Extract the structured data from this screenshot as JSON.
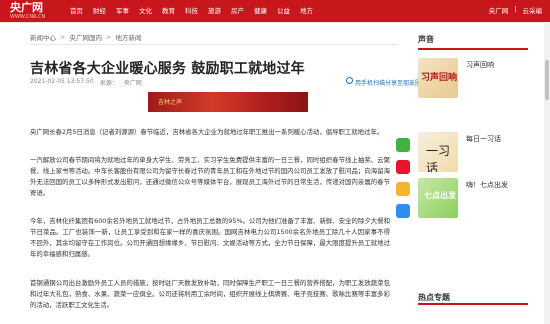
{
  "header": {
    "logo": "央广网",
    "logo_sub": "WWW.CNR.CN",
    "nav": [
      "首页",
      "财经",
      "军事",
      "文化",
      "教育",
      "科技",
      "旅游",
      "房产",
      "健康",
      "公益",
      "地方"
    ],
    "right": [
      "央广网",
      "|",
      "云采编"
    ]
  },
  "breadcrumb": [
    "新闻中心",
    ">",
    "央广网国内",
    ">",
    "地方新闻"
  ],
  "article": {
    "title": "吉林省各大企业暖心服务 鼓励职工就地过年",
    "time": "2021-02-05 13:57:50",
    "source_label": "来源：",
    "source": "央广网",
    "share_text": "用手机扫描分享至朋友圈",
    "photo_caption": "吉林之声",
    "paragraphs": [
      "央广网长春2月5日消息（记者刘源源）春节临近，吉林省各大企业为就地过年职工推出一系列暖心活动，倡导职工就地过年。",
      "一汽解放公司春节期间将为就地过年的单身大学生、劳务工、实习学生免费提供丰富的一日三餐，同时组织春节线上抽奖、云聚餐、线上家书等活动。中车长客股份有限公司为留守长春过节的青年员工和在外地过节的国内公司员工发放了慰问品；向海留海外无法回国的员工以多种形式发出慰问，还通过微信公众号等媒体平台，展现员工海外过节的日常生活，传递对国内亲属的春节寄语。",
      "今年，吉林化纤集团有600余名外地员工就地过节，占外地员工总数的95%。公司为他们准备了丰富、新鲜、安全的除夕大餐和节日菜品。工厂也装饰一新，让员工享受到和在家一样的喜庆氛围。国网吉林电力公司1500余名外地员工除几十人因家事不得不回外，其余均留守在工作岗位。公司开通回想缘缘乡、节日慰问、文娱活动等方式，全力节日保障，最大限度提升员工就地过年的幸福感和归属感。",
      "首钢通钢公司出台激励外员工人员的措施，按时驻厂天数发放补助，同时保障生产职工一日三餐的营养搭配，为职工发放蔬菜包和过年大礼包，熟食、水果、蔬菜一应俱全。公司还将利用工余时间，组织开展线上棋牌赛、电子竞技赛、歌咏比赛等丰富多彩的活动，活跃职工文化生活。"
    ]
  },
  "sidebar": {
    "section_title": "声音",
    "items": [
      {
        "title": "习声回响",
        "thumb_text": "习声回响"
      },
      {
        "title": "每日一习话",
        "sub": "",
        "thumb_text": "一习话"
      },
      {
        "title": "嗨！七点出发",
        "thumb_text": "七点出发"
      }
    ],
    "hot_title": "热点专题"
  },
  "colors": {
    "brand": "#c8161d"
  }
}
